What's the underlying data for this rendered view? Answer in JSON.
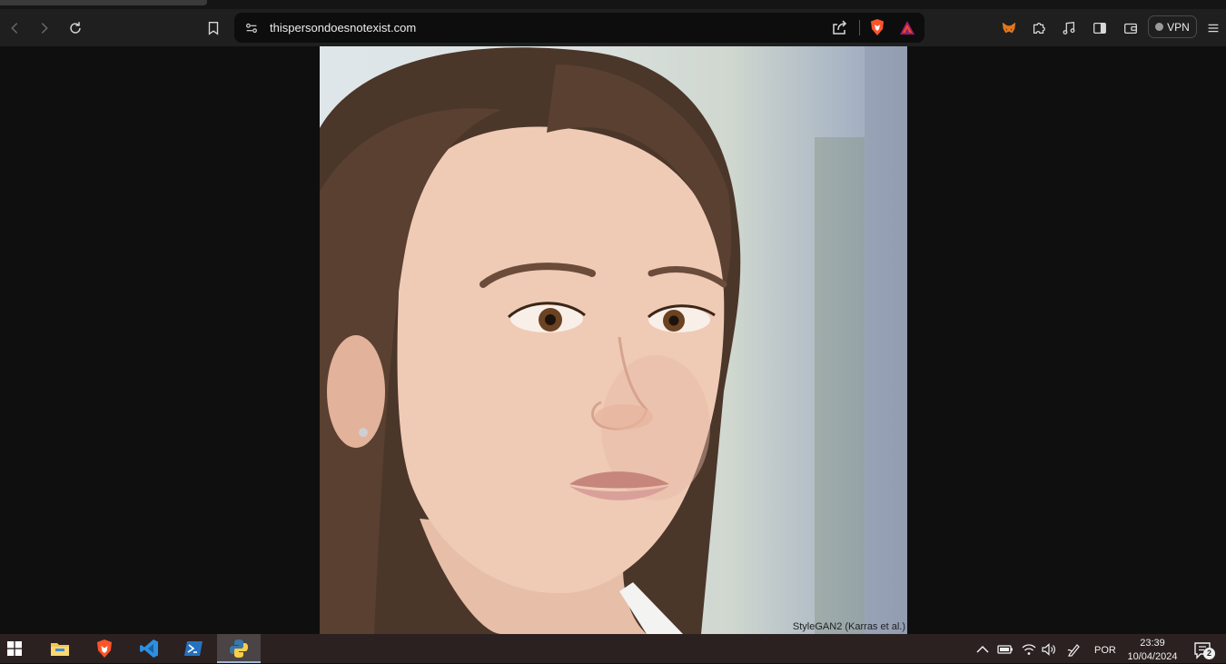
{
  "browser": {
    "url": "thispersondoesnotexist.com",
    "vpn_label": "VPN"
  },
  "page": {
    "image_credit": "StyleGAN2 (Karras et al.)"
  },
  "taskbar": {
    "language": "POR",
    "time": "23:39",
    "date": "10/04/2024",
    "notification_count": "2"
  },
  "colors": {
    "toolbar_bg": "#1f1f1f",
    "urlbar_bg": "#0d0d0d",
    "page_bg": "#0f0f0f",
    "taskbar_bg": "#2b2121",
    "brave_orange": "#fb542b"
  }
}
